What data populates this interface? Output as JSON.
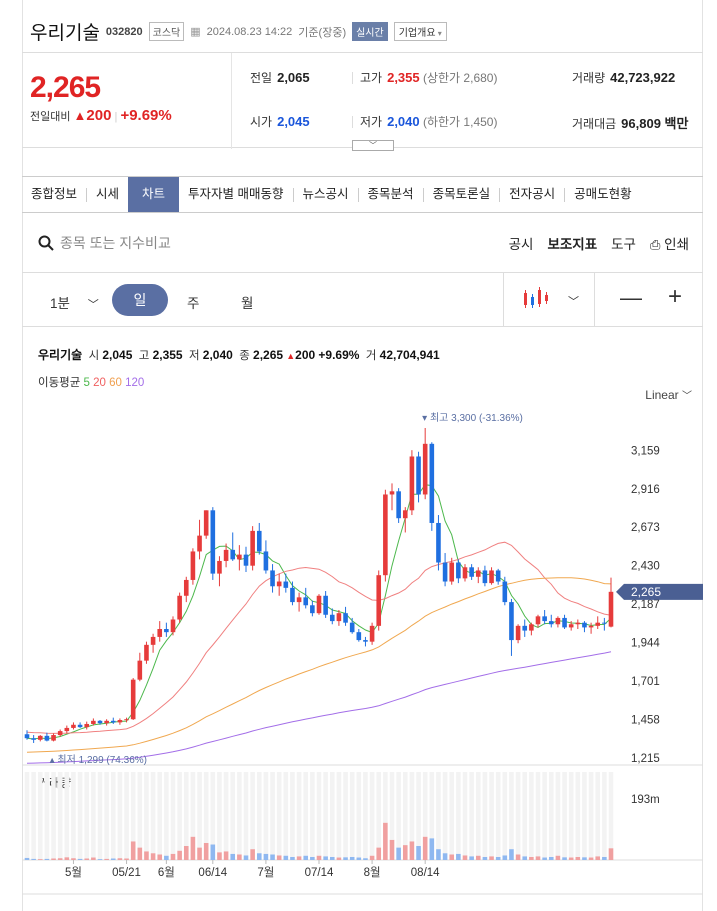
{
  "header": {
    "name": "우리기술",
    "code": "032820",
    "market": "코스닥",
    "datetime": "2024.08.23 14:22",
    "basis": "기준(장중)",
    "live": "실시간",
    "company_btn": "기업개요"
  },
  "price": {
    "current": "2,265",
    "diff_label": "전일대비",
    "diff": "200",
    "pct": "+9.69%"
  },
  "stats": {
    "prev_label": "전일",
    "prev": "2,065",
    "high_label": "고가",
    "high": "2,355",
    "upper_limit": "(상한가 2,680)",
    "volume_label": "거래량",
    "volume": "42,723,922",
    "open_label": "시가",
    "open": "2,045",
    "low_label": "저가",
    "low": "2,040",
    "lower_limit": "(하한가 1,450)",
    "amount_label": "거래대금",
    "amount": "96,809 백만"
  },
  "tabs": [
    "종합정보",
    "시세",
    "차트",
    "투자자별 매매동향",
    "뉴스공시",
    "종목분석",
    "종목토론실",
    "전자공시",
    "공매도현황"
  ],
  "active_tab": "차트",
  "search": {
    "placeholder": "종목 또는 지수비교"
  },
  "tools": {
    "disclosure": "공시",
    "indicator": "보조지표",
    "tool": "도구",
    "print": "인쇄"
  },
  "periods": {
    "minute": "1분",
    "day": "일",
    "week": "주",
    "month": "월"
  },
  "legend": {
    "name": "우리기술",
    "open_label": "시",
    "open": "2,045",
    "high_label": "고",
    "high": "2,355",
    "low_label": "저",
    "low": "2,040",
    "close_label": "종",
    "close": "2,265",
    "change": "200",
    "pct": "+9.69%",
    "vol_label": "거",
    "volume": "42,704,941",
    "ma_label": "이동평균",
    "ma": [
      "5",
      "20",
      "60",
      "120"
    ]
  },
  "scale_label": "Linear",
  "colors": {
    "up": "#e63b3b",
    "down": "#1f6fe0",
    "ma5": "#4cb84c",
    "ma20": "#f08080",
    "ma60": "#f0a850",
    "ma120": "#a36ee8",
    "accent": "#5a6fa3"
  },
  "chart_data": {
    "type": "candlestick",
    "ylim": [
      1215,
      3300
    ],
    "y_ticks": [
      "3,159",
      "2,916",
      "2,673",
      "2,430",
      "2,187",
      "1,944",
      "1,701",
      "1,458",
      "1,215"
    ],
    "y_tick_values": [
      3159,
      2916,
      2673,
      2430,
      2187,
      1944,
      1701,
      1458,
      1215
    ],
    "last_price_label": "2,265",
    "last_price": 2265,
    "max_label": "최고 3,300 (-31.36%)",
    "min_label": "최저 1,299 (74.36%)",
    "x_tick_labels": [
      "5월",
      "05/21",
      "6월",
      "06/14",
      "7월",
      "07/14",
      "8월",
      "08/14"
    ],
    "x_tick_index": [
      7,
      15,
      21,
      28,
      36,
      44,
      52,
      60
    ],
    "volume_label": "거래량",
    "volume_axis_label": "193m",
    "volume_max": 193,
    "candles": [
      [
        1365,
        1390,
        1330,
        1340
      ],
      [
        1340,
        1360,
        1310,
        1330
      ],
      [
        1330,
        1360,
        1320,
        1355
      ],
      [
        1355,
        1375,
        1320,
        1325
      ],
      [
        1325,
        1370,
        1320,
        1360
      ],
      [
        1360,
        1395,
        1350,
        1385
      ],
      [
        1385,
        1420,
        1370,
        1405
      ],
      [
        1405,
        1440,
        1395,
        1425
      ],
      [
        1425,
        1440,
        1405,
        1410
      ],
      [
        1410,
        1445,
        1395,
        1430
      ],
      [
        1430,
        1465,
        1420,
        1450
      ],
      [
        1450,
        1455,
        1425,
        1435
      ],
      [
        1435,
        1460,
        1420,
        1450
      ],
      [
        1450,
        1470,
        1430,
        1440
      ],
      [
        1440,
        1465,
        1425,
        1455
      ],
      [
        1455,
        1470,
        1440,
        1460
      ],
      [
        1460,
        1720,
        1455,
        1710
      ],
      [
        1710,
        1880,
        1700,
        1830
      ],
      [
        1830,
        1950,
        1810,
        1930
      ],
      [
        1930,
        2000,
        1880,
        1980
      ],
      [
        1980,
        2080,
        1950,
        2030
      ],
      [
        2030,
        2070,
        1980,
        2010
      ],
      [
        2010,
        2110,
        1990,
        2090
      ],
      [
        2090,
        2260,
        2070,
        2240
      ],
      [
        2240,
        2360,
        2200,
        2340
      ],
      [
        2340,
        2540,
        2310,
        2520
      ],
      [
        2520,
        2720,
        2470,
        2620
      ],
      [
        2620,
        2780,
        2600,
        2780
      ],
      [
        2780,
        2800,
        2340,
        2380
      ],
      [
        2380,
        2490,
        2300,
        2460
      ],
      [
        2460,
        2570,
        2420,
        2530
      ],
      [
        2530,
        2640,
        2460,
        2470
      ],
      [
        2470,
        2560,
        2400,
        2500
      ],
      [
        2500,
        2550,
        2390,
        2430
      ],
      [
        2430,
        2680,
        2400,
        2650
      ],
      [
        2650,
        2700,
        2500,
        2520
      ],
      [
        2520,
        2590,
        2380,
        2400
      ],
      [
        2400,
        2440,
        2260,
        2300
      ],
      [
        2300,
        2380,
        2240,
        2330
      ],
      [
        2330,
        2380,
        2260,
        2290
      ],
      [
        2290,
        2330,
        2180,
        2200
      ],
      [
        2200,
        2260,
        2140,
        2230
      ],
      [
        2230,
        2290,
        2160,
        2180
      ],
      [
        2180,
        2210,
        2110,
        2130
      ],
      [
        2130,
        2250,
        2120,
        2240
      ],
      [
        2240,
        2270,
        2100,
        2120
      ],
      [
        2120,
        2160,
        2060,
        2080
      ],
      [
        2080,
        2150,
        2050,
        2130
      ],
      [
        2130,
        2170,
        2050,
        2070
      ],
      [
        2070,
        2100,
        2000,
        2010
      ],
      [
        2010,
        2030,
        1950,
        1960
      ],
      [
        1960,
        1980,
        1920,
        1950
      ],
      [
        1950,
        2070,
        1930,
        2050
      ],
      [
        2050,
        2400,
        2020,
        2370
      ],
      [
        2370,
        2910,
        2330,
        2880
      ],
      [
        2880,
        2950,
        2780,
        2900
      ],
      [
        2900,
        2920,
        2700,
        2730
      ],
      [
        2730,
        2800,
        2640,
        2780
      ],
      [
        2780,
        3160,
        2750,
        3120
      ],
      [
        3120,
        3150,
        2830,
        2880
      ],
      [
        2880,
        3300,
        2850,
        3200
      ],
      [
        3200,
        3210,
        2650,
        2700
      ],
      [
        2700,
        2750,
        2400,
        2450
      ],
      [
        2450,
        2510,
        2300,
        2330
      ],
      [
        2330,
        2480,
        2310,
        2450
      ],
      [
        2450,
        2470,
        2320,
        2350
      ],
      [
        2350,
        2440,
        2330,
        2420
      ],
      [
        2420,
        2440,
        2340,
        2360
      ],
      [
        2360,
        2420,
        2320,
        2400
      ],
      [
        2400,
        2430,
        2300,
        2320
      ],
      [
        2320,
        2420,
        2310,
        2400
      ],
      [
        2400,
        2410,
        2310,
        2330
      ],
      [
        2330,
        2360,
        2180,
        2200
      ],
      [
        2200,
        2220,
        1860,
        1960
      ],
      [
        1960,
        2060,
        1940,
        2050
      ],
      [
        2050,
        2090,
        1980,
        2020
      ],
      [
        2020,
        2070,
        1990,
        2060
      ],
      [
        2060,
        2120,
        2040,
        2110
      ],
      [
        2110,
        2150,
        2060,
        2080
      ],
      [
        2080,
        2120,
        2040,
        2060
      ],
      [
        2060,
        2110,
        2040,
        2100
      ],
      [
        2100,
        2120,
        2030,
        2040
      ],
      [
        2040,
        2080,
        2020,
        2060
      ],
      [
        2060,
        2090,
        2030,
        2070
      ],
      [
        2070,
        2080,
        2010,
        2040
      ],
      [
        2040,
        2070,
        2000,
        2050
      ],
      [
        2050,
        2110,
        2030,
        2070
      ],
      [
        2070,
        2100,
        2020,
        2065
      ],
      [
        2045,
        2355,
        2040,
        2265
      ]
    ],
    "volumes": [
      7,
      4,
      3,
      4,
      5,
      6,
      9,
      6,
      4,
      5,
      8,
      3,
      4,
      5,
      6,
      5,
      60,
      40,
      28,
      22,
      18,
      14,
      20,
      30,
      45,
      75,
      40,
      55,
      50,
      25,
      28,
      20,
      18,
      15,
      35,
      22,
      20,
      18,
      15,
      14,
      10,
      12,
      14,
      10,
      14,
      12,
      10,
      8,
      9,
      10,
      8,
      6,
      14,
      40,
      120,
      65,
      40,
      48,
      60,
      45,
      75,
      70,
      35,
      22,
      18,
      20,
      15,
      12,
      14,
      10,
      12,
      10,
      15,
      35,
      18,
      12,
      10,
      12,
      8,
      10,
      14,
      9,
      8,
      10,
      9,
      8,
      12,
      10,
      38
    ]
  }
}
